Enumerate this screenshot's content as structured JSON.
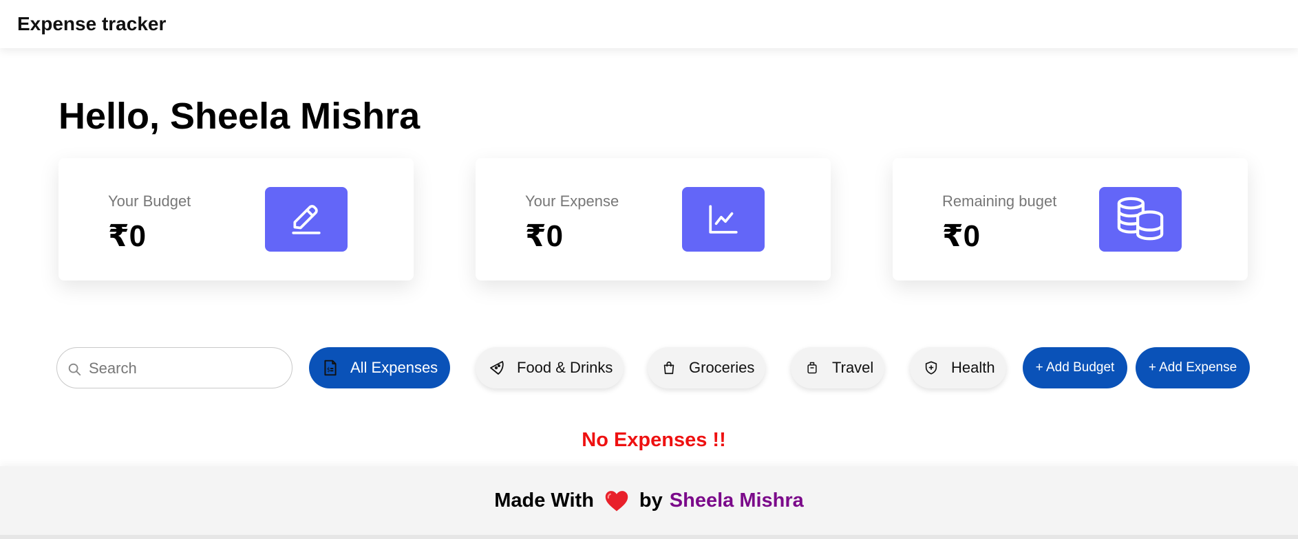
{
  "header": {
    "title": "Expense tracker"
  },
  "greeting": "Hello, Sheela Mishra",
  "cards": [
    {
      "label": "Your Budget",
      "value": "₹0",
      "icon": "pencil-icon"
    },
    {
      "label": "Your Expense",
      "value": "₹0",
      "icon": "chart-line-icon"
    },
    {
      "label": "Remaining buget",
      "value": "₹0",
      "icon": "coins-icon"
    }
  ],
  "search": {
    "placeholder": "Search",
    "value": ""
  },
  "filters": [
    {
      "label": "All Expenses",
      "icon": "receipt-icon",
      "active": true
    },
    {
      "label": "Food & Drinks",
      "icon": "pizza-icon",
      "active": false
    },
    {
      "label": "Groceries",
      "icon": "shopping-bag-icon",
      "active": false
    },
    {
      "label": "Travel",
      "icon": "luggage-icon",
      "active": false
    },
    {
      "label": "Health",
      "icon": "shield-plus-icon",
      "active": false
    }
  ],
  "actions": {
    "add_budget": "+ Add Budget",
    "add_expense": "+ Add Expense"
  },
  "empty_message": "No Expenses !!",
  "footer": {
    "made_with": "Made With",
    "by": "by",
    "author": "Sheela Mishra"
  },
  "colors": {
    "accent": "#6366f8",
    "primary": "#0a52b8",
    "danger": "#ee1111",
    "author": "#7b0a8a"
  }
}
